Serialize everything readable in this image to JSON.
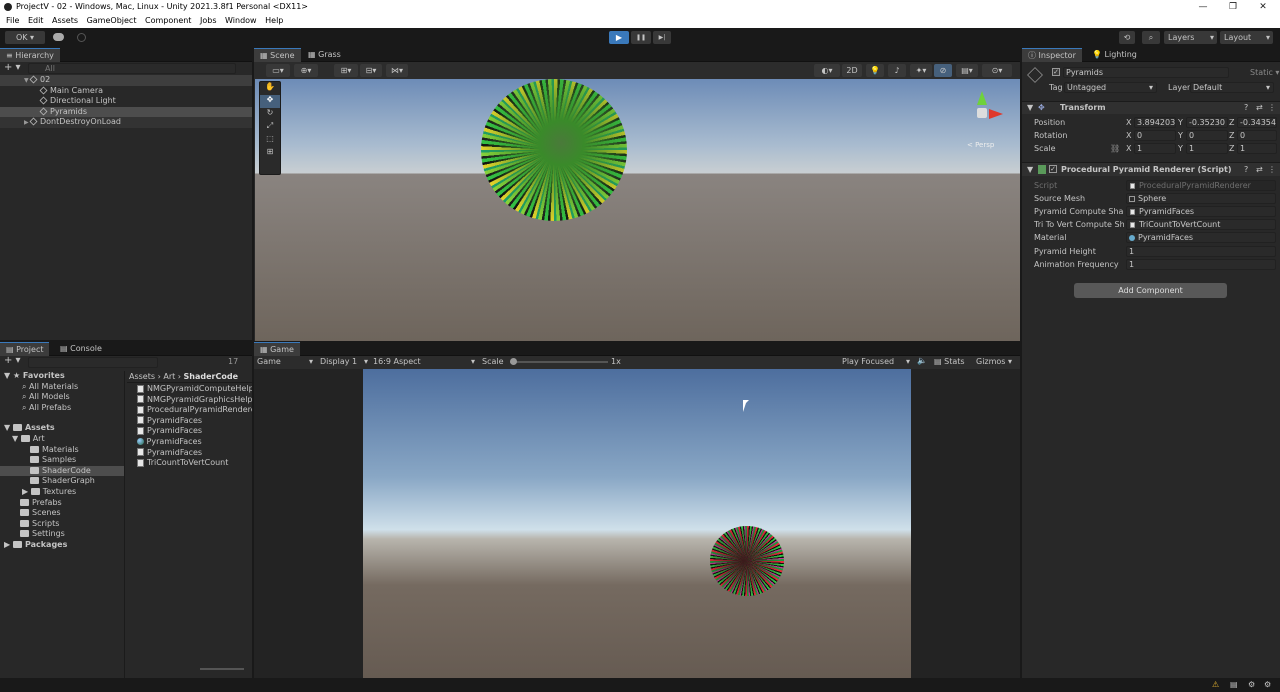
{
  "window": {
    "title": "ProjectV - 02 - Windows, Mac, Linux - Unity 2021.3.8f1 Personal <DX11>",
    "min": "—",
    "max": "❐",
    "close": "✕"
  },
  "menu": [
    "File",
    "Edit",
    "Assets",
    "GameObject",
    "Component",
    "Jobs",
    "Window",
    "Help"
  ],
  "toolbar": {
    "account": "OK",
    "layers": "Layers",
    "layout": "Layout",
    "play": "▶",
    "pause": "❚❚",
    "step": "▶|"
  },
  "hierarchy": {
    "tab": "Hierarchy",
    "search": "All",
    "items": [
      "02",
      "Main Camera",
      "Directional Light",
      "Pyramids",
      "DontDestroyOnLoad"
    ]
  },
  "scene": {
    "tabs": [
      "Scene",
      "Grass"
    ],
    "mode2d": "2D",
    "persp": "< Persp"
  },
  "project": {
    "tabs": [
      "Project",
      "Console"
    ],
    "count": "17",
    "breadcrumb": [
      "Assets",
      "Art",
      "ShaderCode"
    ],
    "favorites": {
      "label": "Favorites",
      "items": [
        "All Materials",
        "All Models",
        "All Prefabs"
      ]
    },
    "assets": {
      "label": "Assets",
      "art": "Art",
      "art_children": [
        "Materials",
        "Samples",
        "ShaderCode",
        "ShaderGraph",
        "Textures"
      ],
      "others": [
        "Prefabs",
        "Scenes",
        "Scripts",
        "Settings"
      ]
    },
    "packages": "Packages",
    "files": [
      "NMGPyramidComputeHelpe",
      "NMGPyramidGraphicsHelpe",
      "ProceduralPyramidRendere",
      "PyramidFaces",
      "PyramidFaces",
      "PyramidFaces",
      "PyramidFaces",
      "TriCountToVertCount"
    ]
  },
  "game": {
    "tab": "Game",
    "mode": "Game",
    "display": "Display 1",
    "aspect": "16:9 Aspect",
    "scale_label": "Scale",
    "scale_value": "1x",
    "play_focused": "Play Focused",
    "stats": "Stats",
    "gizmos": "Gizmos"
  },
  "inspector": {
    "tabs": [
      "Inspector",
      "Lighting"
    ],
    "object_name": "Pyramids",
    "static": "Static",
    "tag_label": "Tag",
    "tag": "Untagged",
    "layer_label": "Layer",
    "layer": "Default",
    "transform": {
      "title": "Transform",
      "position_label": "Position",
      "rotation_label": "Rotation",
      "scale_label": "Scale",
      "position": [
        "3.894203",
        "-0.35230",
        "-0.34354"
      ],
      "rotation": [
        "0",
        "0",
        "0"
      ],
      "scale": [
        "1",
        "1",
        "1"
      ],
      "axes": [
        "X",
        "Y",
        "Z"
      ]
    },
    "script": {
      "title": "Procedural Pyramid Renderer (Script)",
      "fields": [
        {
          "label": "Script",
          "value": "ProceduralPyramidRenderer"
        },
        {
          "label": "Source Mesh",
          "value": "Sphere"
        },
        {
          "label": "Pyramid Compute Shade",
          "value": "PyramidFaces"
        },
        {
          "label": "Tri To Vert Compute Sha",
          "value": "TriCountToVertCount"
        },
        {
          "label": "Material",
          "value": "PyramidFaces"
        },
        {
          "label": "Pyramid Height",
          "value": "1"
        },
        {
          "label": "Animation Frequency",
          "value": "1"
        }
      ]
    },
    "add_component": "Add Component"
  }
}
